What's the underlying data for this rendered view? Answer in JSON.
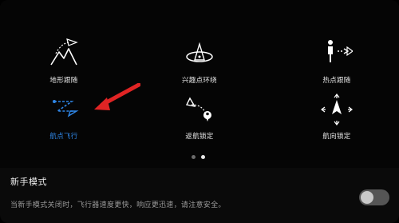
{
  "modes": [
    {
      "label": "地形跟随",
      "icon": "terrain-follow-icon"
    },
    {
      "label": "兴趣点环绕",
      "icon": "poi-orbit-icon"
    },
    {
      "label": "热点跟随",
      "icon": "hotspot-follow-icon"
    },
    {
      "label": "航点飞行",
      "icon": "waypoint-flight-icon",
      "active": true
    },
    {
      "label": "返航锁定",
      "icon": "return-home-lock-icon"
    },
    {
      "label": "航向锁定",
      "icon": "course-lock-icon"
    }
  ],
  "pager": {
    "pages": 2,
    "current": 2
  },
  "novice_mode": {
    "title": "新手模式",
    "description": "当新手模式关闭时，飞行器速度更快，响应更迅速，请注意安全。",
    "enabled": false
  },
  "colors": {
    "active": "#2f86e6",
    "annotation_arrow": "#e02424",
    "background": "#000000"
  }
}
